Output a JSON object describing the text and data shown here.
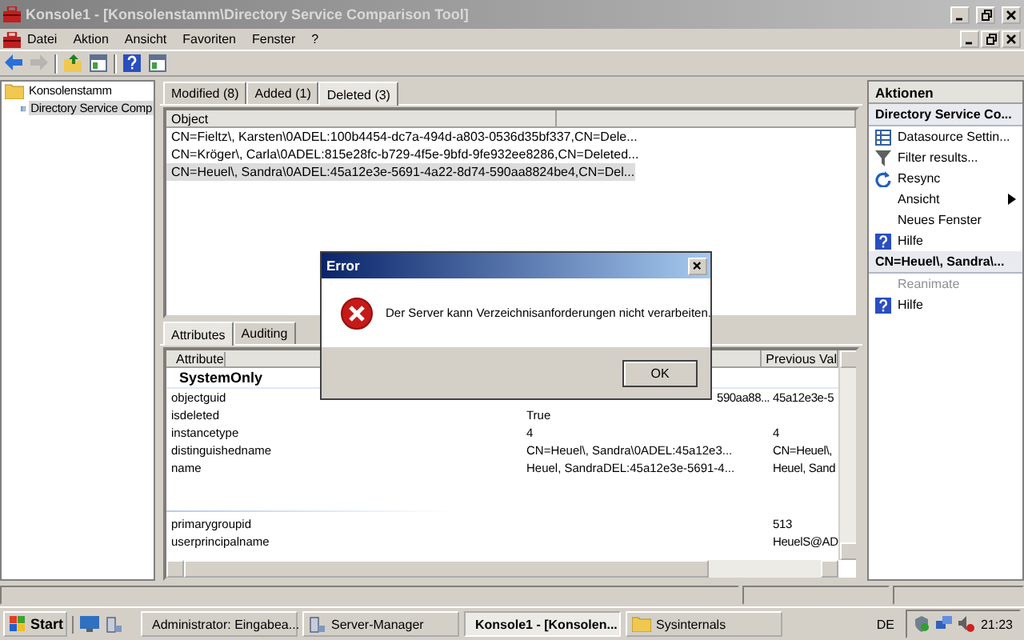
{
  "window": {
    "title": "Konsole1 - [Konsolenstamm\\Directory Service Comparison Tool]"
  },
  "menu": [
    "Datei",
    "Aktion",
    "Ansicht",
    "Favoriten",
    "Fenster",
    "?"
  ],
  "toolbar": [
    {
      "kind": "back",
      "disabled": false
    },
    {
      "kind": "forward",
      "disabled": true
    },
    {
      "kind": "up",
      "disabled": false
    },
    {
      "kind": "pane",
      "disabled": false
    },
    {
      "kind": "help",
      "disabled": false
    },
    {
      "kind": "pane",
      "disabled": false
    }
  ],
  "tree": [
    {
      "label": "Konsolenstamm",
      "selected": false,
      "children": [
        {
          "label": "Directory Service Comp",
          "selected": true
        }
      ]
    }
  ],
  "tabs": [
    {
      "label": "Modified (8)",
      "selected": false
    },
    {
      "label": "Added (1)",
      "selected": false
    },
    {
      "label": "Deleted (3)",
      "selected": true
    }
  ],
  "object_list": {
    "column": "Object",
    "rows": [
      {
        "text": "CN=Fieltz\\, Karsten\\0ADEL:100b4454-dc7a-494d-a803-0536d35bf337,CN=Dele...",
        "selected": false
      },
      {
        "text": "CN=Kröger\\, Carla\\0ADEL:815e28fc-b729-4f5e-9bfd-9fe932ee8286,CN=Deleted...",
        "selected": false
      },
      {
        "text": "CN=Heuel\\, Sandra\\0ADEL:45a12e3e-5691-4a22-8d74-590aa8824be4,CN=Del...",
        "selected": true
      }
    ]
  },
  "detail_tabs": [
    {
      "label": "Attributes",
      "selected": true
    },
    {
      "label": "Auditing",
      "selected": false
    }
  ],
  "attributes": {
    "columns": {
      "attribute": "Attribute",
      "previous": "Previous Val"
    },
    "rows": [
      {
        "kind": "group",
        "label": "SystemOnly"
      },
      {
        "kind": "row",
        "attribute": "objectguid",
        "value": "590aa88...",
        "value_cut": true,
        "previous": "45a12e3e-5"
      },
      {
        "kind": "row",
        "attribute": "isdeleted",
        "value": "True"
      },
      {
        "kind": "row",
        "attribute": "instancetype",
        "value": "4",
        "previous": "4"
      },
      {
        "kind": "row",
        "attribute": "distinguishedname",
        "value": "CN=Heuel\\, Sandra\\0ADEL:45a12e3...",
        "previous": "CN=Heuel\\,"
      },
      {
        "kind": "row",
        "attribute": "name",
        "value": "Heuel, SandraDEL:45a12e3e-5691-4...",
        "previous": "Heuel, Sand"
      },
      {
        "kind": "separator"
      },
      {
        "kind": "row",
        "attribute": "primarygroupid",
        "previous": "513"
      },
      {
        "kind": "row",
        "attribute": "userprincipalname",
        "previous": "HeuelS@AD"
      }
    ]
  },
  "actions": {
    "title": "Aktionen",
    "sections": [
      {
        "title": "Directory Service Co...",
        "items": [
          {
            "label": "Datasource Settin...",
            "kind": "datasource",
            "disabled": false,
            "submenu": false
          },
          {
            "label": "Filter results...",
            "kind": "filter",
            "disabled": false,
            "submenu": false
          },
          {
            "label": "Resync",
            "kind": "refresh",
            "disabled": false,
            "submenu": false
          },
          {
            "label": "Ansicht",
            "kind": "plain",
            "disabled": false,
            "submenu": true
          },
          {
            "label": "Neues Fenster",
            "kind": "plain",
            "disabled": false,
            "submenu": false
          },
          {
            "label": "Hilfe",
            "kind": "help",
            "disabled": false,
            "submenu": false
          }
        ]
      },
      {
        "title": "CN=Heuel\\, Sandra\\...",
        "items": [
          {
            "label": "Reanimate",
            "kind": "plain",
            "disabled": true,
            "submenu": false
          },
          {
            "label": "Hilfe",
            "kind": "help",
            "disabled": false,
            "submenu": false
          }
        ]
      }
    ]
  },
  "dialog": {
    "title": "Error",
    "message": "Der Server kann Verzeichnisanforderungen nicht verarbeiten.",
    "button": "OK"
  },
  "taskbar": {
    "start": "Start",
    "tasks": [
      {
        "label": "Administrator: Eingabea...",
        "kind": "console",
        "selected": false
      },
      {
        "label": "Server-Manager",
        "kind": "server",
        "selected": false
      },
      {
        "label": "Konsole1 - [Konsolen...",
        "kind": "mmc",
        "selected": true
      },
      {
        "label": "Sysinternals",
        "kind": "folder",
        "selected": false
      }
    ],
    "language": "DE",
    "clock": "21:23"
  }
}
